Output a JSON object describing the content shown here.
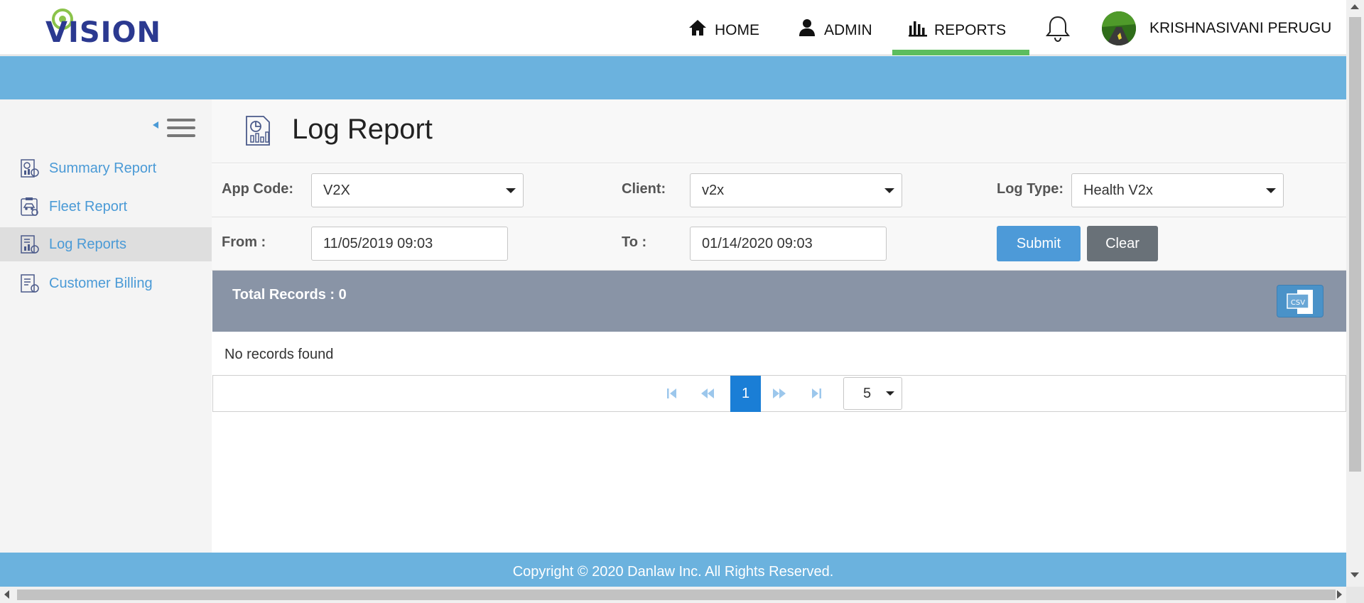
{
  "brand": {
    "logo_text": "VISION",
    "colors": {
      "logo": "#2b3990",
      "pin_ring": "#8bc34a",
      "accent_blue": "#6bb2de",
      "active_tab": "#5cbd5e"
    }
  },
  "nav": {
    "home": {
      "label": "HOME",
      "icon": "home-icon"
    },
    "admin": {
      "label": "ADMIN",
      "icon": "user-icon"
    },
    "reports": {
      "label": "REPORTS",
      "icon": "bar-chart-icon",
      "active": true
    },
    "notifications_icon": "bell-icon",
    "user_name": "KRISHNASIVANI PERUGU"
  },
  "sidebar": {
    "toggle_icon": "hamburger-collapse-icon",
    "items": [
      {
        "label": "Summary Report",
        "icon": "summary-report-icon",
        "active": false
      },
      {
        "label": "Fleet Report",
        "icon": "fleet-report-icon",
        "active": false
      },
      {
        "label": "Log Reports",
        "icon": "log-report-icon",
        "active": true
      },
      {
        "label": "Customer Billing",
        "icon": "customer-billing-icon",
        "active": false
      }
    ]
  },
  "page": {
    "title": "Log Report",
    "icon": "report-chart-icon"
  },
  "filters": {
    "app_code": {
      "label": "App Code:",
      "value": "V2X"
    },
    "client": {
      "label": "Client:",
      "value": "v2x"
    },
    "log_type": {
      "label": "Log Type:",
      "value": "Health V2x"
    },
    "from": {
      "label": "From :",
      "value": "11/05/2019 09:03"
    },
    "to": {
      "label": "To :",
      "value": "01/14/2020 09:03"
    },
    "submit_label": "Submit",
    "clear_label": "Clear"
  },
  "results": {
    "total_label": "Total Records : 0",
    "export_icon": "csv-export-icon",
    "empty_message": "No records found"
  },
  "pagination": {
    "current_page": "1",
    "page_size": "5"
  },
  "footer": {
    "copyright": "Copyright © 2020 Danlaw Inc. All Rights Reserved."
  }
}
